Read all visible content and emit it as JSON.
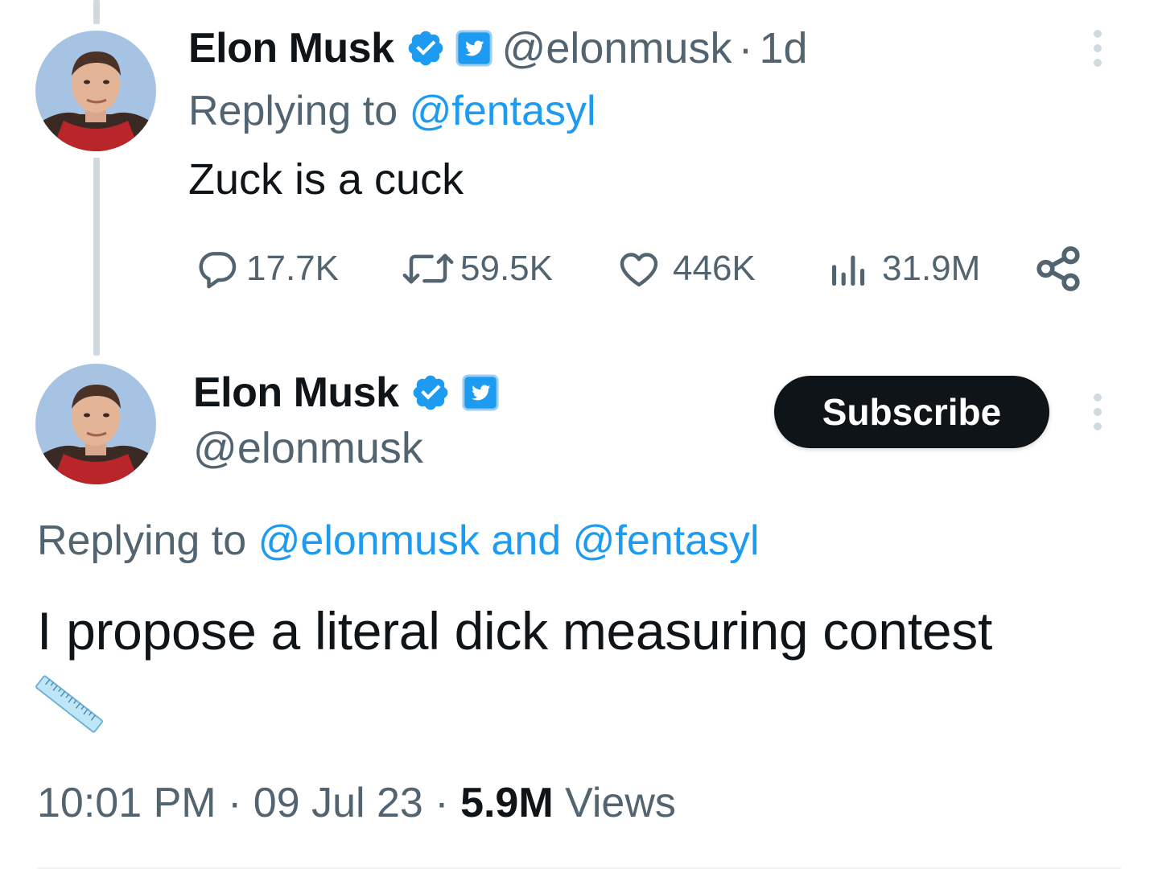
{
  "colors": {
    "accent": "#1d9bf0",
    "text_primary": "#0f1419",
    "text_secondary": "#536471",
    "subscribe_bg": "#0f1419",
    "thread_line": "#cfd9de"
  },
  "tweets": [
    {
      "author": {
        "name": "Elon Musk",
        "handle": "@elonmusk",
        "avatar_icon": "avatar-photo",
        "verified_icon": "verified-badge-icon",
        "affiliate_icon": "twitter-bird-badge-icon"
      },
      "time_separator": "·",
      "time": "1d",
      "replying_prefix": "Replying to ",
      "replying_to": "@fentasyl",
      "text": "Zuck is a cuck",
      "stats": {
        "replies": "17.7K",
        "retweets": "59.5K",
        "likes": "446K",
        "views": "31.9M"
      },
      "icons": [
        "reply-icon",
        "retweet-icon",
        "like-icon",
        "views-icon",
        "share-icon",
        "more-options-icon"
      ]
    },
    {
      "author": {
        "name": "Elon Musk",
        "handle": "@elonmusk",
        "avatar_icon": "avatar-photo",
        "verified_icon": "verified-badge-icon",
        "affiliate_icon": "twitter-bird-badge-icon"
      },
      "subscribe_label": "Subscribe",
      "replying_prefix": "Replying to ",
      "replying_to": "@elonmusk and @fentasyl",
      "text": "I propose a literal dick measuring contest",
      "emoji_icon": "ruler-emoji",
      "meta": {
        "time": "10:01 PM",
        "sep1": " · ",
        "date": "09 Jul 23",
        "sep2": " · ",
        "views_count": "5.9M",
        "views_label": " Views"
      }
    }
  ]
}
